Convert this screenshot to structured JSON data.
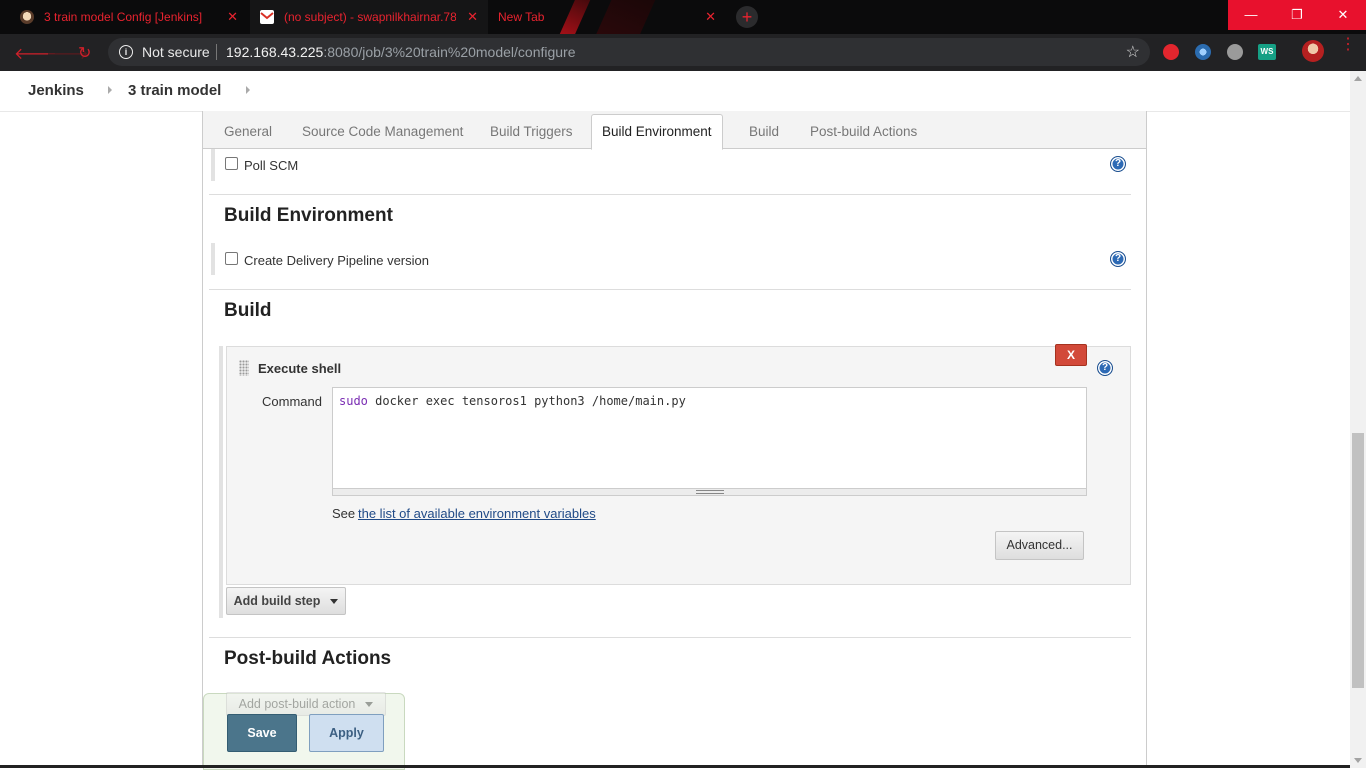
{
  "browser": {
    "tabs": [
      {
        "title": "3 train model Config [Jenkins]",
        "icon": "jenkins-favicon",
        "active": false
      },
      {
        "title": "(no subject) - swapnilkhairnar.78",
        "icon": "gmail-favicon",
        "active": true
      },
      {
        "title": "New Tab",
        "icon": "",
        "active": false
      }
    ],
    "new_tab_symbol": "+",
    "close_symbol": "✕",
    "not_secure_label": "Not secure",
    "url_host": "192.168.43.225",
    "url_rest": ":8080/job/3%20train%20model/configure",
    "extensions": [
      "adblock-icon",
      "extension-icon",
      "download-icon",
      "ws-icon"
    ],
    "ws_label": "WS",
    "window_controls": {
      "minimize": "—",
      "restore": "❐",
      "close": "✕"
    },
    "accent_color": "#e8232f"
  },
  "breadcrumbs": [
    "Jenkins",
    "3 train model"
  ],
  "config_tabs": [
    "General",
    "Source Code Management",
    "Build Triggers",
    "Build Environment",
    "Build",
    "Post-build Actions"
  ],
  "active_tab": "Build Environment",
  "triggers": {
    "poll_scm_label": "Poll SCM",
    "poll_scm_checked": false
  },
  "build_environment": {
    "heading": "Build Environment",
    "pipeline_option_label": "Create Delivery Pipeline version",
    "pipeline_option_checked": false
  },
  "build": {
    "heading": "Build",
    "step": {
      "title": "Execute shell",
      "delete_label": "X",
      "command_label": "Command",
      "command_keyword": "sudo",
      "command_rest": " docker exec tensoros1 python3 /home/main.py",
      "see_prefix": "See ",
      "env_link_text": "the list of available environment variables",
      "advanced_label": "Advanced..."
    },
    "add_step_label": "Add build step"
  },
  "post_build": {
    "heading": "Post-build Actions",
    "add_action_label": "Add post-build action"
  },
  "buttons": {
    "save": "Save",
    "apply": "Apply"
  },
  "help_symbol": "?"
}
